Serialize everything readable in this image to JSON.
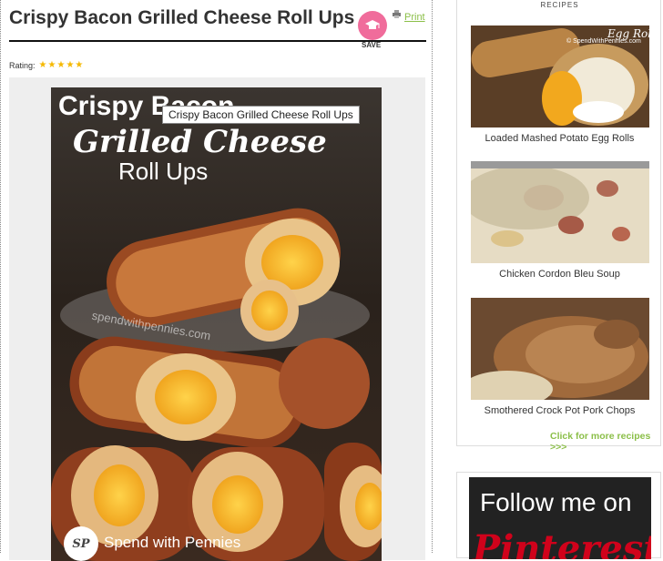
{
  "recipe": {
    "title": "Crispy Bacon Grilled Cheese Roll Ups",
    "save_label": "SAVE",
    "print_label": "Print",
    "rating_label": "Rating:",
    "rating_value": 5,
    "stars": [
      "★",
      "★",
      "★",
      "★",
      "★"
    ]
  },
  "photo": {
    "title_line1": "Crispy Bacon",
    "title_line2": "Grilled Cheese",
    "title_line3": "Roll Ups",
    "tooltip": "Crispy Bacon Grilled Cheese Roll Ups",
    "watermark": "spendwithpennies.com",
    "logo_mark": "SP",
    "brand": "Spend with Pennies"
  },
  "sidebar": {
    "heading": "RECIPES",
    "items": [
      {
        "label": "Loaded Mashed Potato Egg Rolls",
        "img_text": "Egg Rolls",
        "img_credit": "© SpendWithPennies.com"
      },
      {
        "label": "Chicken Cordon Bleu Soup"
      },
      {
        "label": "Smothered Crock Pot Pork Chops"
      }
    ],
    "more_link": "Click for more recipes >>>"
  },
  "follow": {
    "line1": "Follow me on",
    "line2": "Pinterest"
  },
  "colors": {
    "accent_green": "#8bbf48",
    "save_pink": "#f06c9b",
    "star_gold": "#f5b800"
  }
}
